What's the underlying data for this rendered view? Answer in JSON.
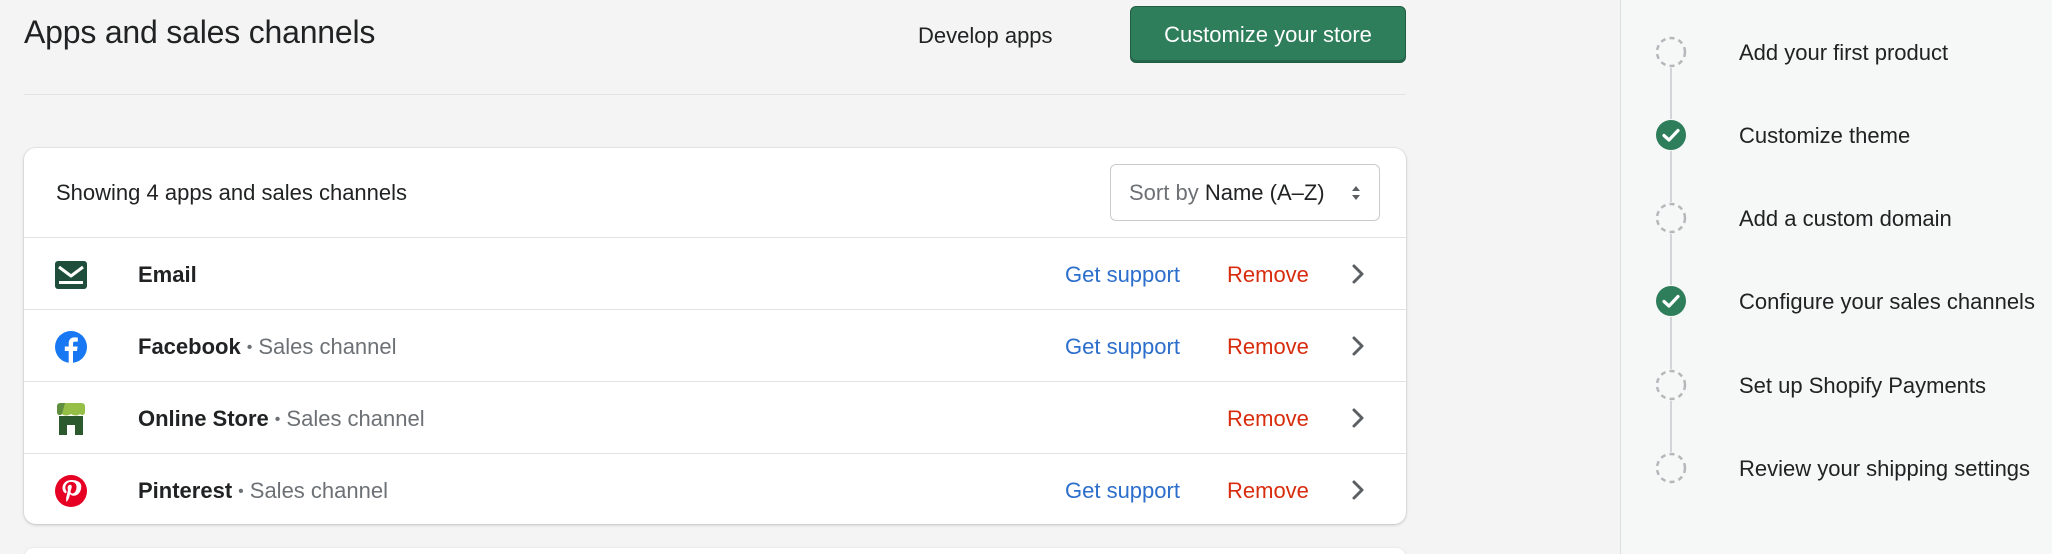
{
  "header": {
    "title": "Apps and sales channels",
    "develop_apps_label": "Develop apps",
    "customize_label": "Customize your store"
  },
  "list": {
    "showing_text": "Showing 4 apps and sales channels",
    "sort_prefix": "Sort by",
    "sort_value": "Name (A–Z)",
    "items": [
      {
        "name": "Email",
        "subtitle": "",
        "icon": "email-icon",
        "get_support": "Get support",
        "remove": "Remove"
      },
      {
        "name": "Facebook",
        "subtitle": "Sales channel",
        "icon": "facebook-icon",
        "get_support": "Get support",
        "remove": "Remove"
      },
      {
        "name": "Online Store",
        "subtitle": "Sales channel",
        "icon": "online-store-icon",
        "get_support": "",
        "remove": "Remove"
      },
      {
        "name": "Pinterest",
        "subtitle": "Sales channel",
        "icon": "pinterest-icon",
        "get_support": "Get support",
        "remove": "Remove"
      }
    ]
  },
  "setup_guide": {
    "steps": [
      {
        "label": "Add your first product",
        "done": false
      },
      {
        "label": "Customize theme",
        "done": true
      },
      {
        "label": "Add a custom domain",
        "done": false
      },
      {
        "label": "Configure your sales channels",
        "done": true
      },
      {
        "label": "Set up Shopify Payments",
        "done": false
      },
      {
        "label": "Review your shipping settings",
        "done": false
      }
    ]
  },
  "colors": {
    "primary": "#2e7d5b",
    "link": "#2c6ecb",
    "critical": "#d72c0d",
    "facebook": "#1877f2",
    "pinterest": "#e60023",
    "email": "#1e4d3c"
  }
}
